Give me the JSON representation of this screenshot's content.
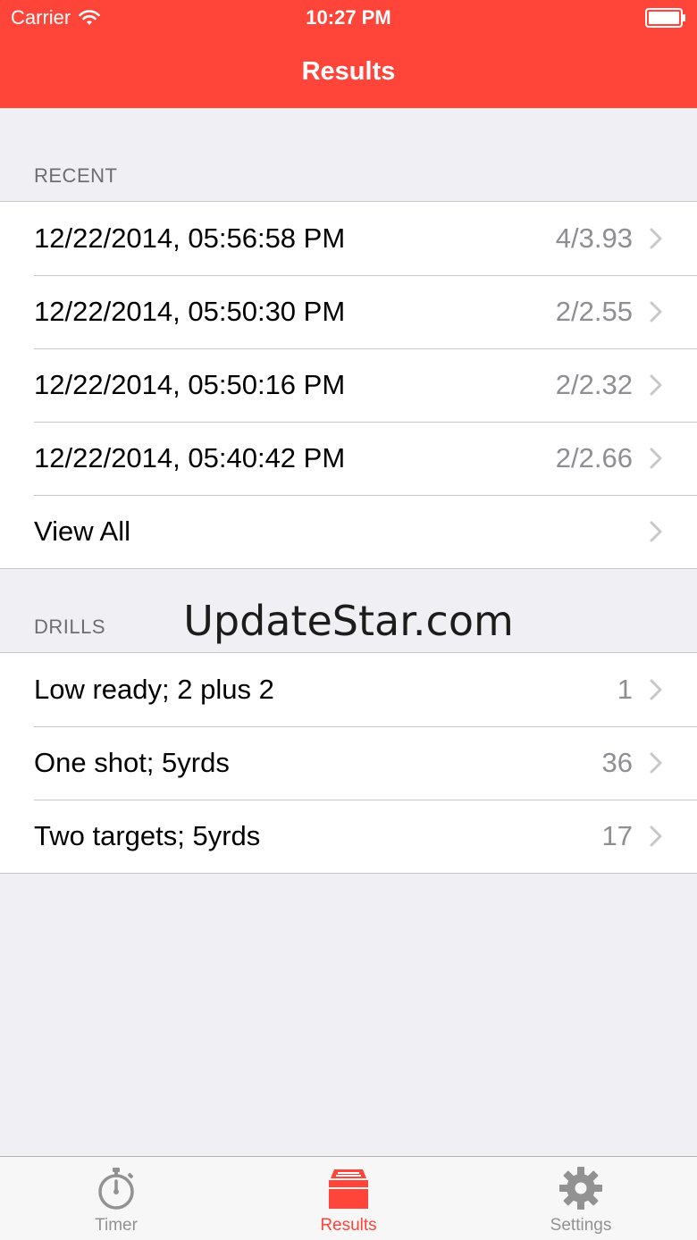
{
  "status_bar": {
    "carrier": "Carrier",
    "time": "10:27 PM"
  },
  "nav": {
    "title": "Results"
  },
  "recent": {
    "header": "RECENT",
    "items": [
      {
        "label": "12/22/2014, 05:56:58 PM",
        "value": "4/3.93"
      },
      {
        "label": "12/22/2014, 05:50:30 PM",
        "value": "2/2.55"
      },
      {
        "label": "12/22/2014, 05:50:16 PM",
        "value": "2/2.32"
      },
      {
        "label": "12/22/2014, 05:40:42 PM",
        "value": "2/2.66"
      }
    ],
    "view_all": "View All"
  },
  "drills": {
    "header": "DRILLS",
    "items": [
      {
        "label": "Low ready; 2 plus 2",
        "value": "1"
      },
      {
        "label": "One shot; 5yrds",
        "value": "36"
      },
      {
        "label": "Two targets; 5yrds",
        "value": "17"
      }
    ]
  },
  "watermark": "UpdateStar.com",
  "tabbar": {
    "tabs": [
      {
        "label": "Timer",
        "icon": "stopwatch-icon",
        "active": false
      },
      {
        "label": "Results",
        "icon": "results-box-icon",
        "active": true
      },
      {
        "label": "Settings",
        "icon": "gear-icon",
        "active": false
      }
    ]
  },
  "colors": {
    "accent": "#ff443a",
    "background": "#efeff4",
    "secondary_text": "#8e8e93",
    "tab_inactive": "#929292"
  }
}
